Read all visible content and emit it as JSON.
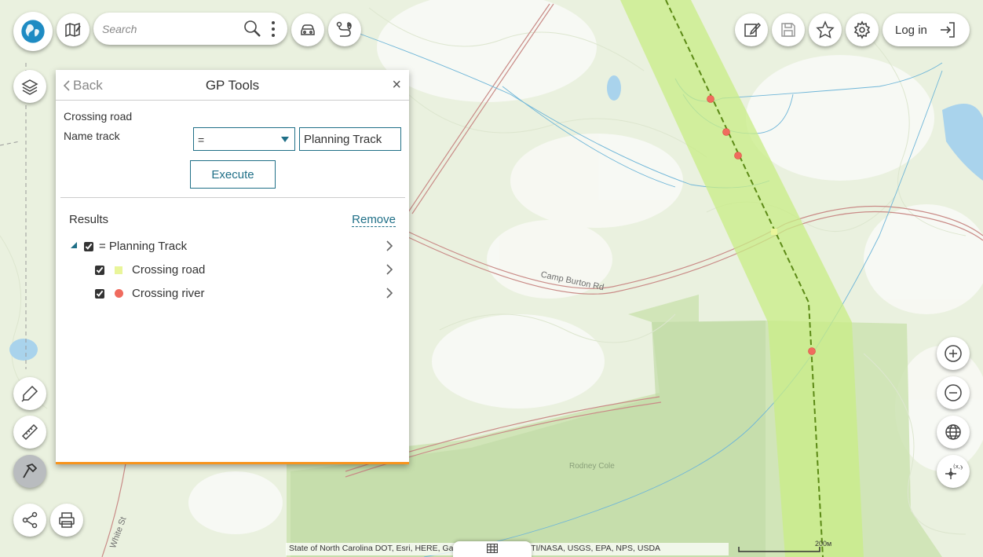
{
  "toolbar": {
    "search_placeholder": "Search",
    "login_label": "Log in"
  },
  "panel": {
    "back_label": "Back",
    "title": "GP Tools",
    "close_label": "×",
    "tool_name": "Crossing road",
    "field_label": "Name track",
    "operator_value": "=",
    "track_value": "Planning Track",
    "execute_label": "Execute",
    "results_label": "Results",
    "remove_label": "Remove",
    "results": {
      "root_label": "= Planning Track",
      "layers": [
        {
          "label": "Crossing road",
          "color": "#e9f59a",
          "shape": "square"
        },
        {
          "label": "Crossing river",
          "color": "#f06b5e",
          "shape": "circle"
        }
      ]
    }
  },
  "map": {
    "road_label": "Camp Burton Rd",
    "road_label_2": "White St",
    "place_label": "Rodney Cole",
    "attribution": "State of North Carolina DOT, Esri, HERE, Garmin, SafeGraph, METI/NASA, USGS, EPA, NPS, USDA"
  },
  "scale": {
    "label": "200м"
  },
  "icons": [
    "globe-icon",
    "map-edit-icon",
    "search-icon",
    "kebab-icon",
    "car-icon",
    "route-icon",
    "layers-icon",
    "draw-icon",
    "ruler-icon",
    "hammer-icon",
    "share-icon",
    "print-icon",
    "edit-icon",
    "save-icon",
    "star-icon",
    "gear-icon",
    "login-icon",
    "zoom-in-icon",
    "zoom-out-icon",
    "globe-grid-icon",
    "xy-icon",
    "table-icon"
  ],
  "colors": {
    "accent": "#1f6f87",
    "panel_bottom": "#f7941d",
    "buffer": "#c8ec86",
    "crossing_point": "#f06b5e"
  }
}
